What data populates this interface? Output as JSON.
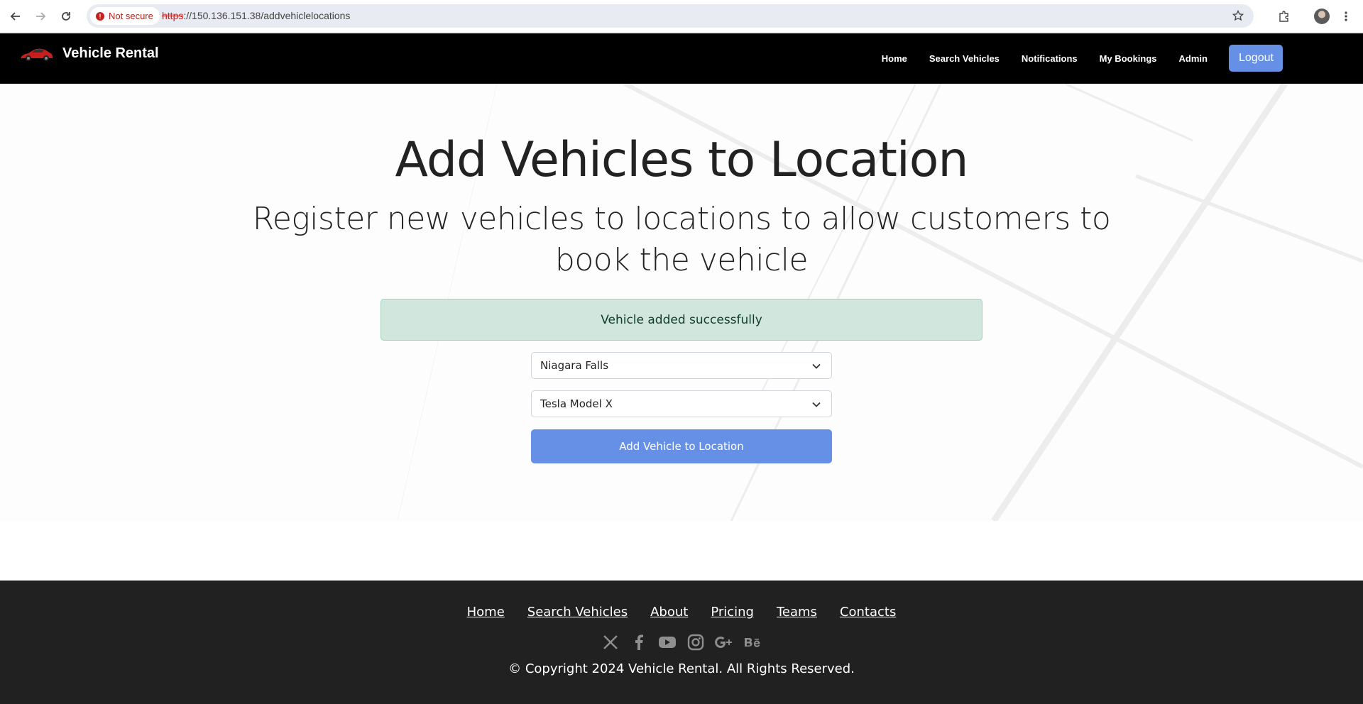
{
  "browser": {
    "security_label": "Not secure",
    "url_scheme": "https",
    "url_rest": "://150.136.151.38/addvehiclelocations"
  },
  "header": {
    "brand": "Vehicle Rental",
    "nav": [
      "Home",
      "Search Vehicles",
      "Notifications",
      "My Bookings",
      "Admin"
    ],
    "logout_label": "Logout"
  },
  "main": {
    "title": "Add Vehicles to Location",
    "subtitle": "Register new vehicles to locations to allow customers to book the vehicle",
    "alert": "Vehicle added successfully",
    "location_select": "Niagara Falls",
    "vehicle_select": "Tesla Model X",
    "submit_label": "Add Vehicle to Location"
  },
  "footer": {
    "links": [
      "Home",
      "Search Vehicles",
      "About",
      "Pricing",
      "Teams",
      "Contacts"
    ],
    "socials": [
      "x-icon",
      "facebook-icon",
      "youtube-icon",
      "instagram-icon",
      "google-plus-icon",
      "behance-icon"
    ],
    "copyright": "© Copyright 2024 Vehicle Rental. All Rights Reserved."
  },
  "colors": {
    "accent": "#6690e6",
    "header_bg": "#000000",
    "footer_bg": "#212121",
    "alert_bg": "#d1e7dd"
  }
}
